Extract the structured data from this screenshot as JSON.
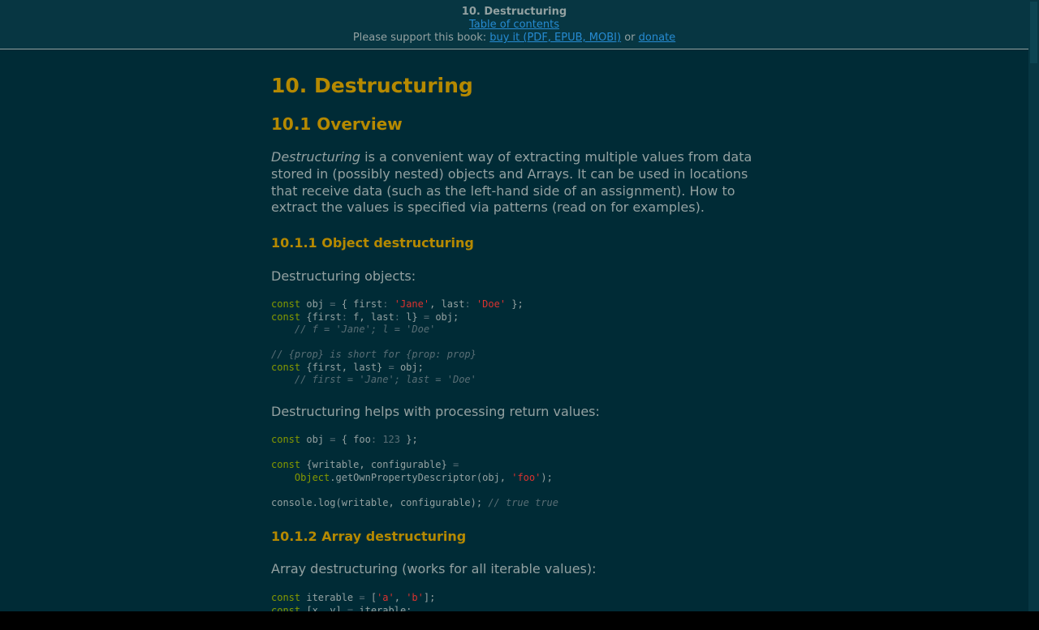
{
  "header": {
    "chapter_title": "10. Destructuring",
    "toc_link": "Table of contents",
    "support_prefix": "Please support this book: ",
    "buy_link": "buy it (PDF, EPUB, MOBI)",
    "or_text": " or ",
    "donate_link": "donate"
  },
  "colors": {
    "background": "#002b36",
    "heading": "#b58900",
    "text": "#93a1a1",
    "link": "#268bd2",
    "keyword": "#859900",
    "string": "#dc322f",
    "comment": "#586e75"
  },
  "article": {
    "h1": "10. Destructuring",
    "h2_overview": "10.1 Overview",
    "intro_em": "Destructuring",
    "intro_line1_rest": " is a convenient way of extracting multiple values from data",
    "intro_line2": "stored in (possibly nested) objects and Arrays. It can be used in locations",
    "intro_line3": "that receive data (such as the left-hand side of an assignment). How to",
    "intro_line4": "extract the values is specified via patterns (read on for examples).",
    "h3_object": "10.1.1 Object destructuring",
    "p_objects": "Destructuring objects:",
    "code1": [
      [
        {
          "t": "const",
          "c": "kw"
        },
        {
          "t": " obj "
        },
        {
          "t": "=",
          "c": "op"
        },
        {
          "t": " { first"
        },
        {
          "t": ":",
          "c": "op"
        },
        {
          "t": " "
        },
        {
          "t": "'Jane'",
          "c": "str"
        },
        {
          "t": ", last"
        },
        {
          "t": ":",
          "c": "op"
        },
        {
          "t": " "
        },
        {
          "t": "'Doe'",
          "c": "str"
        },
        {
          "t": " };"
        }
      ],
      [
        {
          "t": "const",
          "c": "kw"
        },
        {
          "t": " {first"
        },
        {
          "t": ":",
          "c": "op"
        },
        {
          "t": " f, last"
        },
        {
          "t": ":",
          "c": "op"
        },
        {
          "t": " l} "
        },
        {
          "t": "=",
          "c": "op"
        },
        {
          "t": " obj;"
        }
      ],
      [
        {
          "t": "    "
        },
        {
          "t": "// f = 'Jane'; l = 'Doe'",
          "c": "cm"
        }
      ],
      [],
      [
        {
          "t": "// {prop} is short for {prop: prop}",
          "c": "cm"
        }
      ],
      [
        {
          "t": "const",
          "c": "kw"
        },
        {
          "t": " {first, last} "
        },
        {
          "t": "=",
          "c": "op"
        },
        {
          "t": " obj;"
        }
      ],
      [
        {
          "t": "    "
        },
        {
          "t": "// first = 'Jane'; last = 'Doe'",
          "c": "cm"
        }
      ]
    ],
    "p_return": "Destructuring helps with processing return values:",
    "code2": [
      [
        {
          "t": "const",
          "c": "kw"
        },
        {
          "t": " obj "
        },
        {
          "t": "=",
          "c": "op"
        },
        {
          "t": " { foo"
        },
        {
          "t": ":",
          "c": "op"
        },
        {
          "t": " "
        },
        {
          "t": "123",
          "c": "num"
        },
        {
          "t": " };"
        }
      ],
      [],
      [
        {
          "t": "const",
          "c": "kw"
        },
        {
          "t": " {writable, configurable} "
        },
        {
          "t": "=",
          "c": "op"
        }
      ],
      [
        {
          "t": "    "
        },
        {
          "t": "Object",
          "c": "bi"
        },
        {
          "t": ".getOwnPropertyDescriptor(obj, "
        },
        {
          "t": "'foo'",
          "c": "str"
        },
        {
          "t": ");"
        }
      ],
      [],
      [
        {
          "t": "console.log(writable, configurable); "
        },
        {
          "t": "// true true",
          "c": "cm"
        }
      ]
    ],
    "h3_array": "10.1.2 Array destructuring",
    "p_array": "Array destructuring (works for all iterable values):",
    "code3": [
      [
        {
          "t": "const",
          "c": "kw"
        },
        {
          "t": " iterable "
        },
        {
          "t": "=",
          "c": "op"
        },
        {
          "t": " ["
        },
        {
          "t": "'a'",
          "c": "str"
        },
        {
          "t": ", "
        },
        {
          "t": "'b'",
          "c": "str"
        },
        {
          "t": "];"
        }
      ],
      [
        {
          "t": "const",
          "c": "kw"
        },
        {
          "t": " [x, y] "
        },
        {
          "t": "=",
          "c": "op"
        },
        {
          "t": " iterable;"
        }
      ]
    ]
  }
}
